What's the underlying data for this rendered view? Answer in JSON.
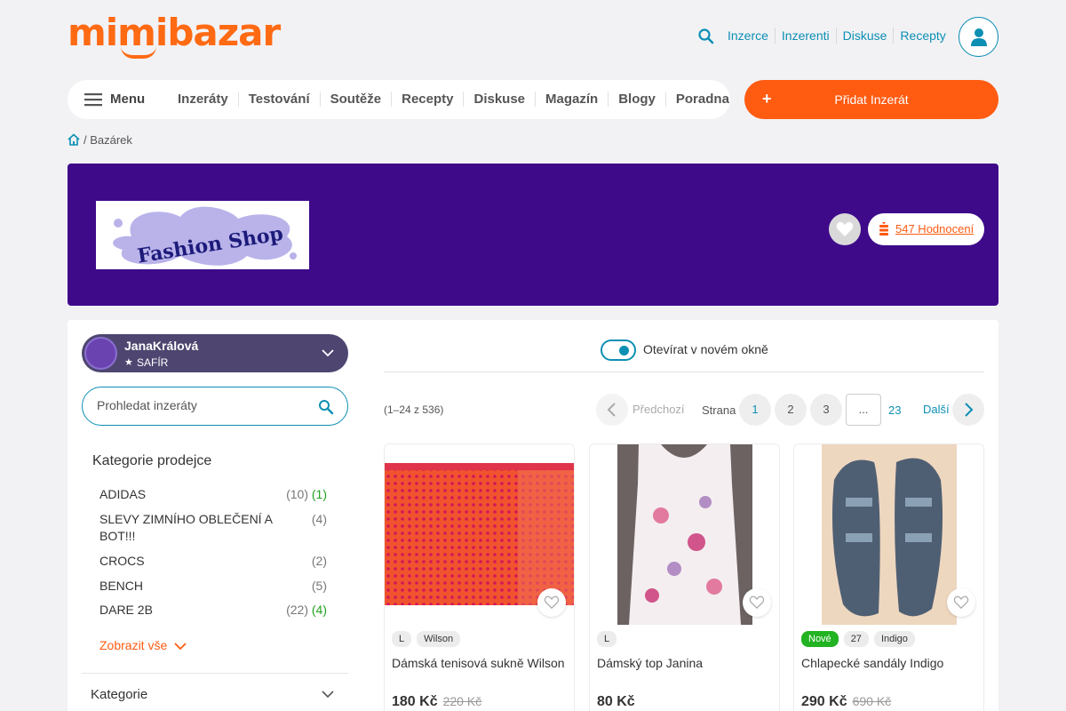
{
  "header": {
    "logo": "mimibazar",
    "links": [
      "Inzerce",
      "Inzerenti",
      "Diskuse",
      "Recepty"
    ]
  },
  "nav": {
    "menu_label": "Menu",
    "items": [
      "Inzeráty",
      "Testování",
      "Soutěže",
      "Recepty",
      "Diskuse",
      "Magazín",
      "Blogy",
      "Poradna"
    ],
    "add_button": "Přidat Inzerát",
    "add_plus": "+"
  },
  "breadcrumb": {
    "sep_label": "/ Bazárek"
  },
  "banner": {
    "shop_logo_text": "Fashion Shop",
    "rating_link": "547 Hodnocení",
    "bg_color": "#3e0a8a"
  },
  "seller": {
    "name": "JanaKrálová",
    "level": "SAFÍR"
  },
  "search": {
    "placeholder": "Prohledat inzeráty"
  },
  "categories": {
    "title": "Kategorie prodejce",
    "items": [
      {
        "name": "ADIDAS",
        "count": "(10)",
        "new": "(1)"
      },
      {
        "name": "SLEVY ZIMNÍHO OBLEČENÍ A BOT!!!",
        "count": "(4)",
        "new": ""
      },
      {
        "name": "CROCS",
        "count": "(2)",
        "new": ""
      },
      {
        "name": "BENCH",
        "count": "(5)",
        "new": ""
      },
      {
        "name": "DARE 2B",
        "count": "(22)",
        "new": "(4)"
      }
    ],
    "show_all": "Zobrazit vše",
    "kategorie_label": "Kategorie"
  },
  "toolbar": {
    "toggle_label": "Otevírat v novém okně",
    "count_text": "(1–24 z 536)",
    "prev_label": "Předchozí",
    "page_label": "Strana",
    "pages": [
      "1",
      "2",
      "3"
    ],
    "ellipsis": "...",
    "last_page": "23",
    "next_label": "Další"
  },
  "products": [
    {
      "tags": [
        "L",
        "Wilson"
      ],
      "is_new": false,
      "title": "Dámská tenisová sukně Wilson",
      "price": "180 Kč",
      "old_price": "220 Kč"
    },
    {
      "tags": [
        "L"
      ],
      "is_new": false,
      "title": "Dámský top Janina",
      "price": "80 Kč",
      "old_price": ""
    },
    {
      "tags": [
        "Nové",
        "27",
        "Indigo"
      ],
      "is_new": true,
      "title": "Chlapecké sandály Indigo",
      "price": "290 Kč",
      "old_price": "690 Kč"
    }
  ],
  "colors": {
    "brand_orange": "#ff5b11",
    "link_blue": "#0d8fb3",
    "new_green": "#22b322"
  }
}
